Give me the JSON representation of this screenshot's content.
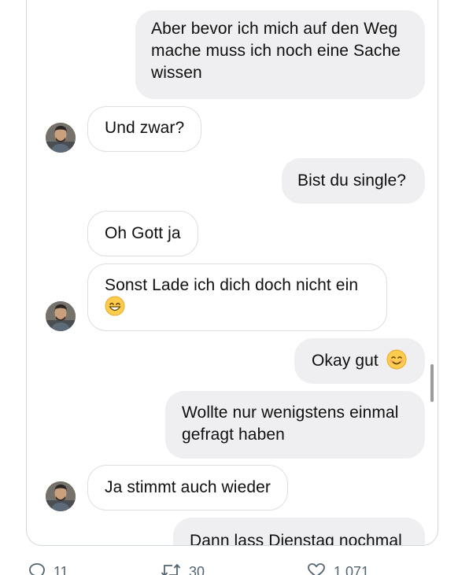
{
  "conversation": {
    "messages": [
      {
        "sender": "me",
        "text_lines": [
          "Aber bevor ich mich auf den Weg",
          "mache muss ich noch eine Sache",
          "wissen"
        ]
      },
      {
        "sender": "them",
        "text": "Und zwar?"
      },
      {
        "sender": "me",
        "text": "Bist du single?"
      },
      {
        "sender": "them",
        "text": "Oh Gott ja"
      },
      {
        "sender": "them",
        "text": "Sonst Lade ich dich doch nicht ein",
        "emoji": "grinning-face-with-smiling-eyes"
      },
      {
        "sender": "me",
        "text": "Okay gut",
        "emoji": "smiling-face-with-smiling-eyes"
      },
      {
        "sender": "me",
        "text_lines": [
          "Wollte nur wenigstens einmal",
          "gefragt haben"
        ]
      },
      {
        "sender": "them",
        "text": "Ja stimmt auch wieder"
      },
      {
        "sender": "me",
        "text": "Dann lass Dienstag nochmal"
      }
    ]
  },
  "tweet_actions": {
    "replies": {
      "icon": "reply-icon",
      "count": "11"
    },
    "retweets": {
      "icon": "retweet-icon",
      "count": "30"
    },
    "likes": {
      "icon": "heart-icon",
      "count": "1.071"
    }
  },
  "colors": {
    "outgoing_bubble": "#efeff1",
    "incoming_border": "#dedede",
    "card_border": "#cfd9de",
    "action_gray": "#536471"
  }
}
